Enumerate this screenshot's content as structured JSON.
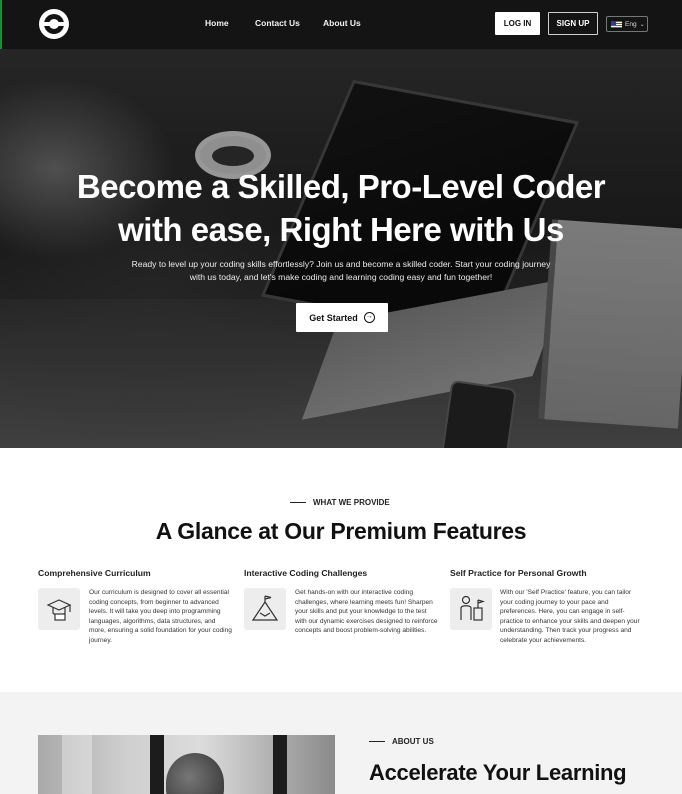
{
  "nav": {
    "links": [
      "Home",
      "Contact Us",
      "About Us"
    ],
    "login_label": "LOG IN",
    "signup_label": "SIGN UP",
    "language": "Eng"
  },
  "hero": {
    "title_line1": "Become a Skilled, Pro-Level Coder",
    "title_line2": "with ease, Right Here with Us",
    "subtitle": "Ready to level up your coding skills effortlessly? Join us and become a skilled coder. Start your coding journey with us today, and let's make coding and learning coding easy and fun together!",
    "cta_label": "Get Started"
  },
  "features": {
    "eyebrow": "WHAT WE PROVIDE",
    "heading": "A Glance at Our Premium Features",
    "items": [
      {
        "title": "Comprehensive Curriculum",
        "icon": "graduation-cap-icon",
        "text": "Our curriculum is designed to cover all essential coding concepts, from beginner to advanced levels. It will take you deep into programming languages, algorithms, data structures, and more, ensuring a solid foundation for your coding journey."
      },
      {
        "title": "Interactive Coding Challenges",
        "icon": "mountain-flag-icon",
        "text": "Get hands-on with our interactive coding challenges, where learning meets fun! Sharpen your skills and put your knowledge to the test with our dynamic exercises designed to reinforce concepts and boost problem-solving abilities."
      },
      {
        "title": "Self Practice for Personal Growth",
        "icon": "person-podium-icon",
        "text": "With our 'Self Practice' feature, you can tailor your coding journey to your pace and preferences. Here, you can engage in self-practice to enhance your skills and deepen your understanding. Then track your progress and celebrate your achievements."
      }
    ]
  },
  "about": {
    "eyebrow": "ABOUT US",
    "heading": "Accelerate Your Learning"
  }
}
